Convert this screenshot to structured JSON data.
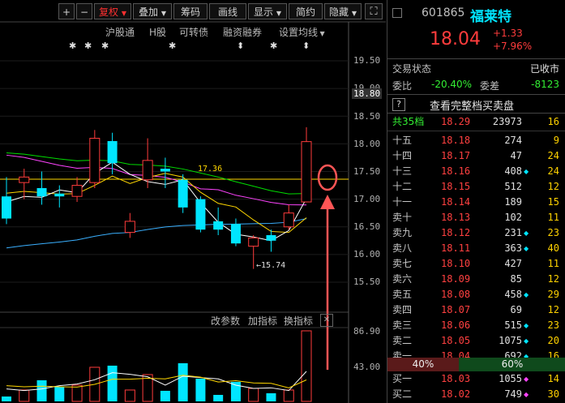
{
  "toolbar": {
    "plus": "+",
    "minus": "−",
    "fuquan": "复权",
    "diejia": "叠加",
    "chouma": "筹码",
    "huaxian": "画线",
    "xianshi": "显示",
    "jianyue": "简约",
    "yincang": "隐藏"
  },
  "subbar": {
    "hgt": "沪股通",
    "h": "H股",
    "kezhuan": "可转债",
    "rongzi": "融资融券",
    "junxian": "设置均线"
  },
  "price_axis": [
    "19.50",
    "19.00",
    "18.80",
    "18.50",
    "18.00",
    "17.50",
    "17.00",
    "16.50",
    "16.00",
    "15.50"
  ],
  "annotations": {
    "high_line": "17.36",
    "low_label": "15.74"
  },
  "indicator_bar": {
    "params": "改参数",
    "add": "加指标",
    "switch": "换指标"
  },
  "volume_axis": [
    "86.90",
    "43.00"
  ],
  "colors": {
    "up": "#ff3c3c",
    "down": "#00e5ff",
    "ma5": "#ffffff",
    "ma10": "#ffd700",
    "ma20": "#ff44ff",
    "ma30": "#00dd00",
    "ma60": "#3ab0ff",
    "annotation": "#ff5555"
  },
  "quote": {
    "code": "601865",
    "name": "福莱特",
    "price": "18.04",
    "change": "+1.33",
    "change_pct": "+7.96%",
    "status_label": "交易状态",
    "status_value": "已收市",
    "weibi_label": "委比",
    "weibi_value": "-20.40%",
    "weicha_label": "委差",
    "weicha_value": "-8123",
    "full_book": "查看完整档买卖盘",
    "help": "?",
    "total_label": "共35档",
    "total_price": "18.29",
    "total_vol": "23973",
    "total_cnt": "16",
    "sell_pct": "40%",
    "buy_pct": "60%",
    "asks": [
      {
        "label": "十五",
        "price": "18.18",
        "vol": "274",
        "dot": "",
        "cnt": "9"
      },
      {
        "label": "十四",
        "price": "18.17",
        "vol": "47",
        "dot": "",
        "cnt": "24"
      },
      {
        "label": "十三",
        "price": "18.16",
        "vol": "408",
        "dot": "cyan",
        "cnt": "24"
      },
      {
        "label": "十二",
        "price": "18.15",
        "vol": "512",
        "dot": "",
        "cnt": "12"
      },
      {
        "label": "十一",
        "price": "18.14",
        "vol": "189",
        "dot": "",
        "cnt": "15"
      },
      {
        "label": "卖十",
        "price": "18.13",
        "vol": "102",
        "dot": "",
        "cnt": "11"
      },
      {
        "label": "卖九",
        "price": "18.12",
        "vol": "231",
        "dot": "cyan",
        "cnt": "23"
      },
      {
        "label": "卖八",
        "price": "18.11",
        "vol": "363",
        "dot": "cyan",
        "cnt": "40"
      },
      {
        "label": "卖七",
        "price": "18.10",
        "vol": "427",
        "dot": "",
        "cnt": "11"
      },
      {
        "label": "卖六",
        "price": "18.09",
        "vol": "85",
        "dot": "",
        "cnt": "12"
      },
      {
        "label": "卖五",
        "price": "18.08",
        "vol": "458",
        "dot": "cyan",
        "cnt": "29"
      },
      {
        "label": "卖四",
        "price": "18.07",
        "vol": "69",
        "dot": "",
        "cnt": "12"
      },
      {
        "label": "卖三",
        "price": "18.06",
        "vol": "515",
        "dot": "cyan",
        "cnt": "23"
      },
      {
        "label": "卖二",
        "price": "18.05",
        "vol": "1075",
        "dot": "cyan",
        "cnt": "20"
      },
      {
        "label": "卖一",
        "price": "18.04",
        "vol": "692",
        "dot": "cyan",
        "cnt": "16"
      }
    ],
    "bids": [
      {
        "label": "买一",
        "price": "18.03",
        "vol": "1055",
        "dot": "magenta",
        "cnt": "14"
      },
      {
        "label": "买二",
        "price": "18.02",
        "vol": "749",
        "dot": "magenta",
        "cnt": "30"
      }
    ]
  },
  "chart_data": {
    "type": "candlestick",
    "ylim": [
      15.3,
      19.7
    ],
    "candles": [
      {
        "o": 17.05,
        "h": 17.4,
        "c": 16.65,
        "l": 16.55,
        "v": 6
      },
      {
        "o": 17.3,
        "h": 17.55,
        "c": 17.4,
        "l": 17.0,
        "v": 14
      },
      {
        "o": 17.2,
        "h": 17.5,
        "c": 17.05,
        "l": 16.9,
        "v": 26
      },
      {
        "o": 17.1,
        "h": 17.25,
        "c": 17.05,
        "l": 16.85,
        "v": 18
      },
      {
        "o": 17.05,
        "h": 17.4,
        "c": 17.25,
        "l": 16.95,
        "v": 20
      },
      {
        "o": 17.3,
        "h": 18.25,
        "c": 18.1,
        "l": 17.2,
        "v": 42
      },
      {
        "o": 18.05,
        "h": 18.2,
        "c": 17.65,
        "l": 17.45,
        "v": 44
      },
      {
        "o": 16.4,
        "h": 16.75,
        "c": 16.6,
        "l": 16.3,
        "v": 14
      },
      {
        "o": 17.35,
        "h": 18.1,
        "c": 17.7,
        "l": 17.2,
        "v": 33
      },
      {
        "o": 17.55,
        "h": 17.75,
        "c": 17.5,
        "l": 17.2,
        "v": 13
      },
      {
        "o": 17.35,
        "h": 17.45,
        "c": 16.85,
        "l": 16.75,
        "v": 47
      },
      {
        "o": 17.0,
        "h": 17.05,
        "c": 16.45,
        "l": 16.4,
        "v": 28
      },
      {
        "o": 16.6,
        "h": 16.85,
        "c": 16.45,
        "l": 16.35,
        "v": 8
      },
      {
        "o": 16.55,
        "h": 16.65,
        "c": 16.2,
        "l": 16.15,
        "v": 24
      },
      {
        "o": 16.15,
        "h": 16.35,
        "c": 16.3,
        "l": 15.74,
        "v": 16
      },
      {
        "o": 16.35,
        "h": 16.45,
        "c": 16.25,
        "l": 16.05,
        "v": 10
      },
      {
        "o": 16.5,
        "h": 16.9,
        "c": 16.75,
        "l": 16.45,
        "v": 14
      },
      {
        "o": 16.95,
        "h": 18.3,
        "c": 18.04,
        "l": 16.95,
        "v": 86.9
      }
    ]
  }
}
